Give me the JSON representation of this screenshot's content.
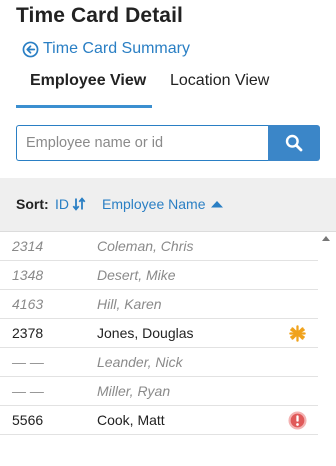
{
  "header": {
    "title": "Time Card Detail"
  },
  "back_link": {
    "label": "Time Card Summary",
    "icon": "arrow-left-circle-icon"
  },
  "tabs": [
    {
      "label": "Employee View",
      "active": true
    },
    {
      "label": "Location View",
      "active": false
    }
  ],
  "search": {
    "placeholder": "Employee name or id",
    "value": "",
    "button_icon": "search-icon"
  },
  "sort": {
    "label": "Sort:",
    "id_label": "ID",
    "name_label": "Employee Name",
    "active": "Employee Name",
    "direction": "ascending"
  },
  "employees": [
    {
      "id": "2314",
      "name": "Coleman, Chris",
      "active": false,
      "status_icon": ""
    },
    {
      "id": "1348",
      "name": "Desert, Mike",
      "active": false,
      "status_icon": ""
    },
    {
      "id": "4163",
      "name": "Hill, Karen",
      "active": false,
      "status_icon": ""
    },
    {
      "id": "2378",
      "name": "Jones, Douglas",
      "active": true,
      "status_icon": "asterisk-icon"
    },
    {
      "id": "— —",
      "name": "Leander, Nick",
      "active": false,
      "status_icon": ""
    },
    {
      "id": "— —",
      "name": "Miller, Ryan",
      "active": false,
      "status_icon": ""
    },
    {
      "id": "5566",
      "name": "Cook, Matt",
      "active": true,
      "status_icon": "alert-icon"
    }
  ],
  "colors": {
    "link": "#2a7fc4",
    "tab_underline": "#3b8fd0",
    "search_button": "#3b86c8",
    "asterisk": "#f0a21c",
    "alert": "#e05a5a"
  }
}
